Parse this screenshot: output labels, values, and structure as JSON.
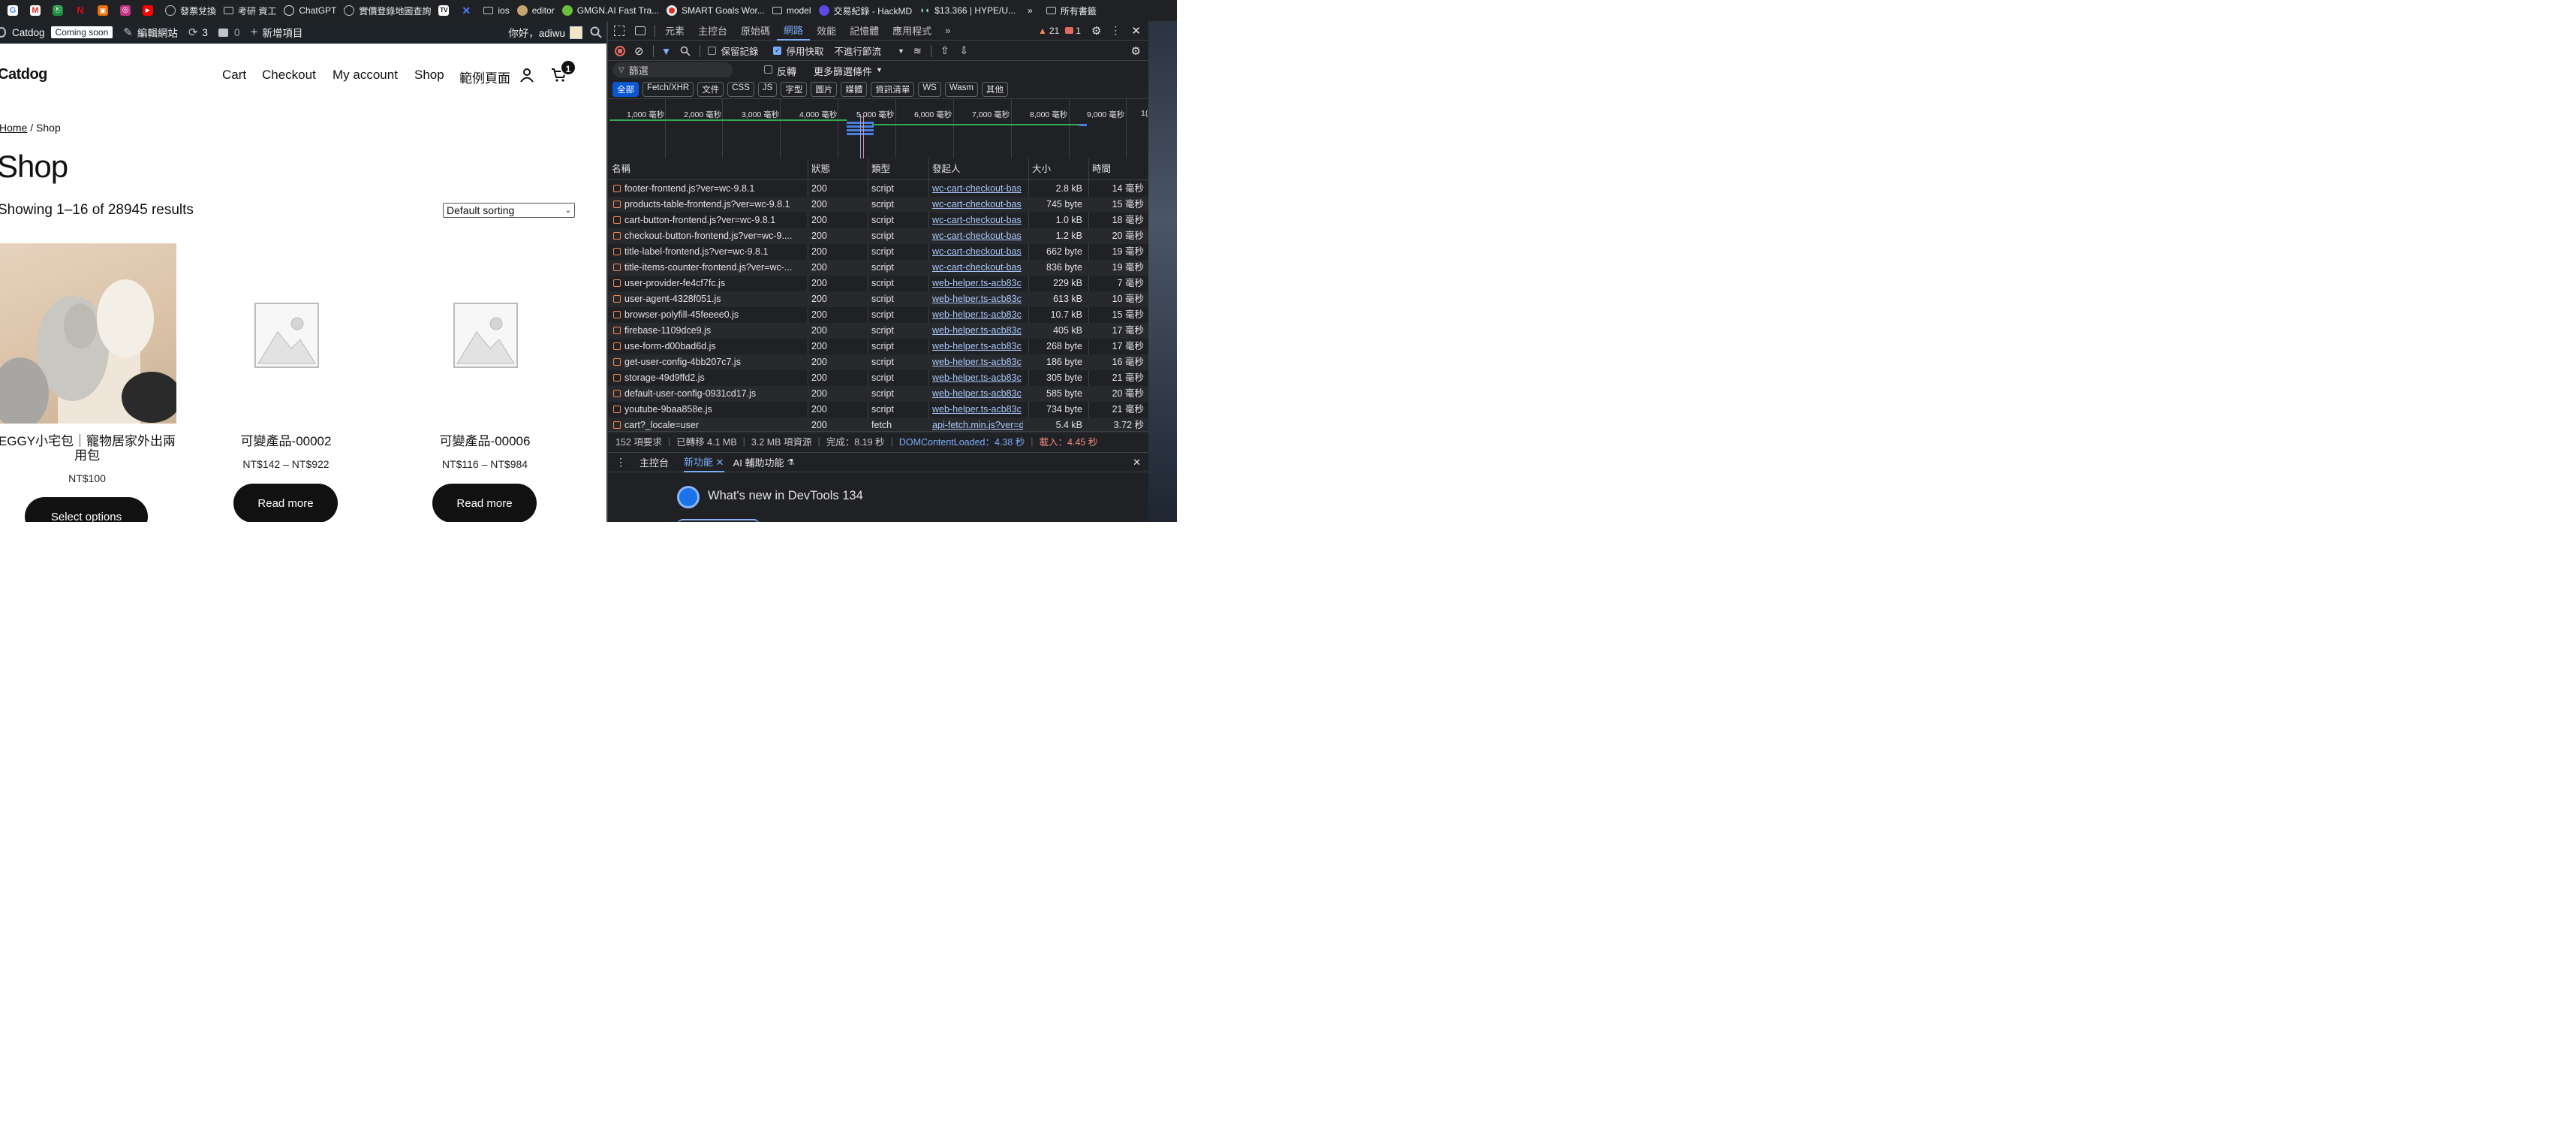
{
  "bookmarks": [
    "G",
    "M",
    "Ⓚ",
    "N",
    "▣",
    "◎",
    "▶",
    "發票兌換",
    "考研 資工",
    "ChatGPT",
    "實價登錄地圖查詢",
    "TV",
    "✕",
    "ios",
    "editor",
    "GMGN.AI Fast Tra...",
    "SMART Goals Wor...",
    "model",
    "交易紀錄 - HackMD",
    "$13.366 | HYPE/U...",
    "»",
    "所有書籤"
  ],
  "admin": {
    "site": "Catdog",
    "coming": "Coming soon",
    "edit": "編輯網站",
    "updates": "3",
    "comments": "0",
    "new": "新增項目",
    "hello": "你好，adiwu"
  },
  "site": {
    "logo": "Catdog",
    "nav": [
      "Cart",
      "Checkout",
      "My account",
      "Shop",
      "範例頁面"
    ],
    "cart_count": "1",
    "bread_home": "Home",
    "bread_rest": " / Shop",
    "title": "Shop",
    "result_count": "Showing 1–16 of 28945 results",
    "sort": "Default sorting",
    "products": [
      {
        "title": "EGGY小宅包｜寵物居家外出兩用包",
        "price": "NT$100",
        "button": "Select options"
      },
      {
        "title": "可變產品-00002",
        "price": "NT$142 – NT$922",
        "button": "Read more"
      },
      {
        "title": "可變產品-00006",
        "price": "NT$116 – NT$984",
        "button": "Read more"
      }
    ]
  },
  "devtools": {
    "tabs": [
      "元素",
      "主控台",
      "原始碼",
      "網路",
      "效能",
      "記憶體",
      "應用程式",
      "»"
    ],
    "warnings": "21",
    "errors": "1",
    "preserve_log": "保留記錄",
    "disable_cache": "停用快取",
    "throttle": "不進行節流",
    "filter_placeholder": "篩選",
    "invert": "反轉",
    "more_filters": "更多篩選條件",
    "chips": [
      "全部",
      "Fetch/XHR",
      "文件",
      "CSS",
      "JS",
      "字型",
      "圖片",
      "媒體",
      "資訊清單",
      "WS",
      "Wasm",
      "其他"
    ],
    "ticks": [
      "1,000 毫秒",
      "2,000 毫秒",
      "3,000 毫秒",
      "4,000 毫秒",
      "5,000 毫秒",
      "6,000 毫秒",
      "7,000 毫秒",
      "8,000 毫秒",
      "9,000 毫秒",
      "1("
    ],
    "headers": [
      "名稱",
      "狀態",
      "類型",
      "發起人",
      "大小",
      "時間"
    ],
    "rows": [
      [
        "footer-frontend.js?ver=wc-9.8.1",
        "200",
        "script",
        "wc-cart-checkout-bas",
        "2.8 kB",
        "14 毫秒"
      ],
      [
        "products-table-frontend.js?ver=wc-9.8.1",
        "200",
        "script",
        "wc-cart-checkout-bas",
        "745 byte",
        "15 毫秒"
      ],
      [
        "cart-button-frontend.js?ver=wc-9.8.1",
        "200",
        "script",
        "wc-cart-checkout-bas",
        "1.0 kB",
        "18 毫秒"
      ],
      [
        "checkout-button-frontend.js?ver=wc-9....",
        "200",
        "script",
        "wc-cart-checkout-bas",
        "1.2 kB",
        "20 毫秒"
      ],
      [
        "title-label-frontend.js?ver=wc-9.8.1",
        "200",
        "script",
        "wc-cart-checkout-bas",
        "662 byte",
        "19 毫秒"
      ],
      [
        "title-items-counter-frontend.js?ver=wc-...",
        "200",
        "script",
        "wc-cart-checkout-bas",
        "836 byte",
        "19 毫秒"
      ],
      [
        "user-provider-fe4cf7fc.js",
        "200",
        "script",
        "web-helper.ts-acb83c",
        "229 kB",
        "7 毫秒"
      ],
      [
        "user-agent-4328f051.js",
        "200",
        "script",
        "web-helper.ts-acb83c",
        "613 kB",
        "10 毫秒"
      ],
      [
        "browser-polyfill-45feeee0.js",
        "200",
        "script",
        "web-helper.ts-acb83c",
        "10.7 kB",
        "15 毫秒"
      ],
      [
        "firebase-1109dce9.js",
        "200",
        "script",
        "web-helper.ts-acb83c",
        "405 kB",
        "17 毫秒"
      ],
      [
        "use-form-d00bad6d.js",
        "200",
        "script",
        "web-helper.ts-acb83c",
        "268 byte",
        "17 毫秒"
      ],
      [
        "get-user-config-4bb207c7.js",
        "200",
        "script",
        "web-helper.ts-acb83c",
        "186 byte",
        "16 毫秒"
      ],
      [
        "storage-49d9ffd2.js",
        "200",
        "script",
        "web-helper.ts-acb83c",
        "305 byte",
        "21 毫秒"
      ],
      [
        "default-user-config-0931cd17.js",
        "200",
        "script",
        "web-helper.ts-acb83c",
        "585 byte",
        "20 毫秒"
      ],
      [
        "youtube-9baa858e.js",
        "200",
        "script",
        "web-helper.ts-acb83c",
        "734 byte",
        "21 毫秒"
      ],
      [
        "cart?_locale=user",
        "200",
        "fetch",
        "api-fetch.min.js?ver=d",
        "5.4 kB",
        "3.72 秒"
      ]
    ],
    "status": {
      "requests": "152 項要求",
      "transferred": "已轉移 4.1 MB",
      "resources": "3.2 MB 項資源",
      "finish": "完成：8.19 秒",
      "dcl": "DOMContentLoaded：4.38 秒",
      "load": "載入：4.45 秒"
    },
    "drawer_tabs": [
      "主控台",
      "新功能",
      "AI 輔助功能"
    ],
    "whats_new": "What's new in DevTools 134"
  },
  "colors": {
    "accent": "#7cacf8",
    "dcl": "#7cacf8",
    "load": "#f28b82",
    "record": "#e46962"
  }
}
